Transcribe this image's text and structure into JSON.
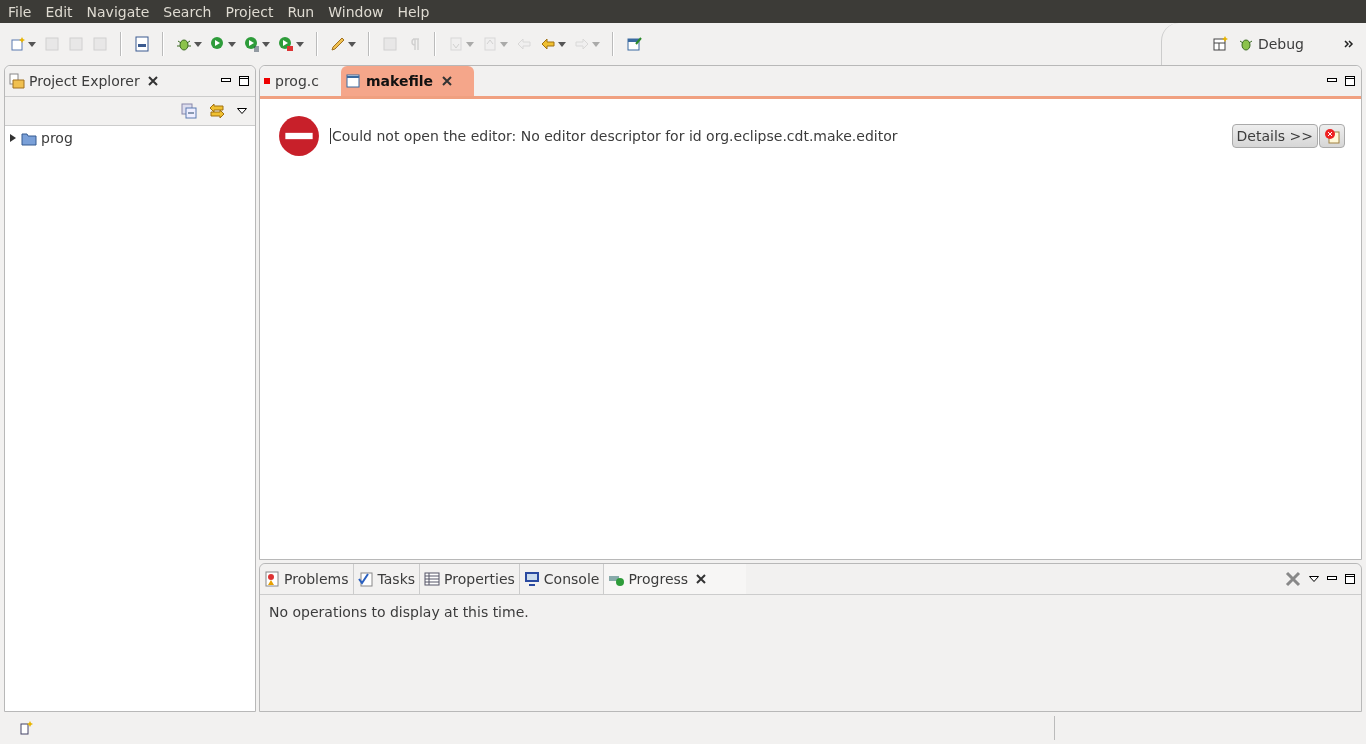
{
  "menu": [
    "File",
    "Edit",
    "Navigate",
    "Search",
    "Project",
    "Run",
    "Window",
    "Help"
  ],
  "toolbar": [
    {
      "kind": "new",
      "enabled": true,
      "dropdown": true
    },
    {
      "kind": "save",
      "enabled": false,
      "dropdown": false
    },
    {
      "kind": "save-all",
      "enabled": false,
      "dropdown": false
    },
    {
      "kind": "print",
      "enabled": false,
      "dropdown": false
    },
    {
      "kind": "sep"
    },
    {
      "kind": "binary",
      "enabled": true,
      "dropdown": false
    },
    {
      "kind": "sep"
    },
    {
      "kind": "debug",
      "enabled": true,
      "dropdown": true
    },
    {
      "kind": "run",
      "enabled": true,
      "dropdown": true
    },
    {
      "kind": "coverage",
      "enabled": true,
      "dropdown": true
    },
    {
      "kind": "external",
      "enabled": true,
      "dropdown": true
    },
    {
      "kind": "sep"
    },
    {
      "kind": "pen",
      "enabled": true,
      "dropdown": true
    },
    {
      "kind": "sep"
    },
    {
      "kind": "block",
      "enabled": false,
      "dropdown": false
    },
    {
      "kind": "pilcrow",
      "enabled": false,
      "dropdown": false
    },
    {
      "kind": "sep"
    },
    {
      "kind": "down",
      "enabled": false,
      "dropdown": true
    },
    {
      "kind": "up",
      "enabled": false,
      "dropdown": true
    },
    {
      "kind": "last-edit",
      "enabled": false,
      "dropdown": false
    },
    {
      "kind": "back",
      "enabled": true,
      "dropdown": true
    },
    {
      "kind": "forward",
      "enabled": false,
      "dropdown": true
    },
    {
      "kind": "sep"
    },
    {
      "kind": "pin",
      "enabled": true,
      "dropdown": false
    }
  ],
  "perspective": {
    "label": "Debug"
  },
  "explorer": {
    "title": "Project Explorer",
    "tree": [
      {
        "label": "prog",
        "expanded": false
      }
    ]
  },
  "editor": {
    "tabs": [
      {
        "label": "prog.c",
        "kind": "c-file",
        "selected": false
      },
      {
        "label": "makefile",
        "kind": "text-file",
        "selected": true
      }
    ],
    "error": {
      "message": "Could not open the editor: No editor descriptor for id org.eclipse.cdt.make.editor",
      "details": "Details >>"
    }
  },
  "bottom": {
    "tabs": [
      {
        "label": "Problems",
        "kind": "problems",
        "selected": false
      },
      {
        "label": "Tasks",
        "kind": "tasks",
        "selected": false
      },
      {
        "label": "Properties",
        "kind": "properties",
        "selected": false
      },
      {
        "label": "Console",
        "kind": "console",
        "selected": false
      },
      {
        "label": "Progress",
        "kind": "progress",
        "selected": true
      }
    ],
    "message": "No operations to display at this time."
  }
}
